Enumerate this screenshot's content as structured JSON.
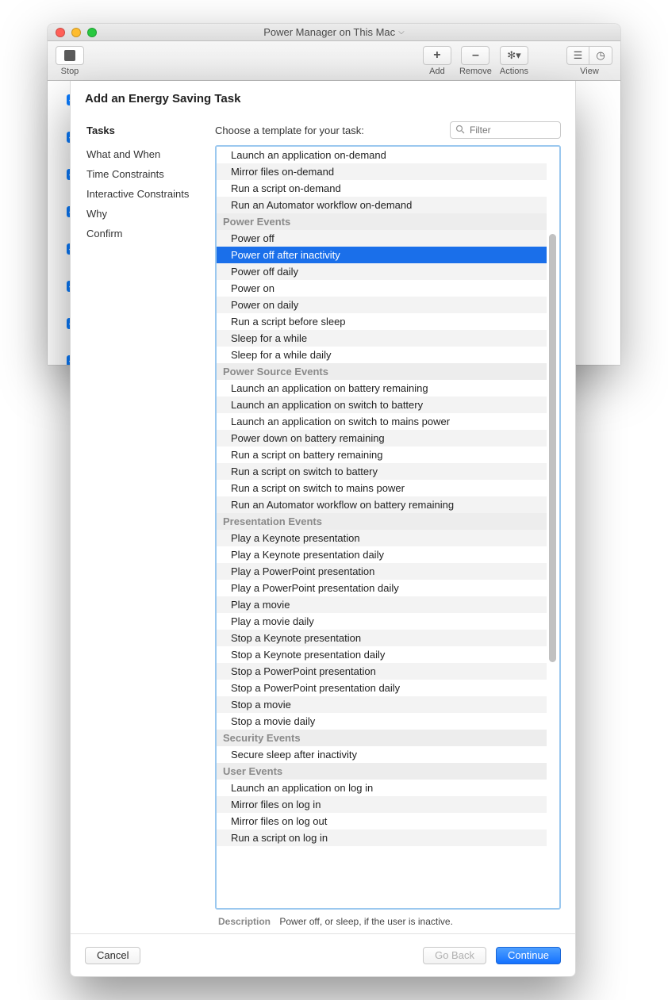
{
  "window": {
    "title": "Power Manager on This Mac"
  },
  "toolbar": {
    "stop_label": "Stop",
    "add_label": "Add",
    "remove_label": "Remove",
    "actions_label": "Actions",
    "view_label": "View"
  },
  "sheet": {
    "title": "Add an Energy Saving Task",
    "sidebar_heading": "Tasks",
    "nav": {
      "what_when": "What and When",
      "time_constraints": "Time Constraints",
      "interactive_constraints": "Interactive Constraints",
      "why": "Why",
      "confirm": "Confirm"
    },
    "prompt": "Choose a template for your task:",
    "filter_placeholder": "Filter",
    "description_label": "Description",
    "description_text": "Power off, or sleep, if the user is inactive.",
    "cancel": "Cancel",
    "go_back": "Go Back",
    "continue": "Continue"
  },
  "templates": {
    "r0": "Launch an application on-demand",
    "r1": "Mirror files on-demand",
    "r2": "Run a script on-demand",
    "r3": "Run an Automator workflow on-demand",
    "g_power": "Power Events",
    "r4": "Power off",
    "r5": "Power off after inactivity",
    "r6": "Power off daily",
    "r7": "Power on",
    "r8": "Power on daily",
    "r9": "Run a script before sleep",
    "r10": "Sleep for a while",
    "r11": "Sleep for a while daily",
    "g_source": "Power Source Events",
    "r12": "Launch an application on battery remaining",
    "r13": "Launch an application on switch to battery",
    "r14": "Launch an application on switch to mains power",
    "r15": "Power down on battery remaining",
    "r16": "Run a script on battery remaining",
    "r17": "Run a script on switch to battery",
    "r18": "Run a script on switch to mains power",
    "r19": "Run an Automator workflow on battery remaining",
    "g_presentation": "Presentation Events",
    "r20": "Play a Keynote presentation",
    "r21": "Play a Keynote presentation daily",
    "r22": "Play a PowerPoint presentation",
    "r23": "Play a PowerPoint presentation daily",
    "r24": "Play a movie",
    "r25": "Play a movie daily",
    "r26": "Stop a Keynote presentation",
    "r27": "Stop a Keynote presentation daily",
    "r28": "Stop a PowerPoint presentation",
    "r29": "Stop a PowerPoint presentation daily",
    "r30": "Stop a movie",
    "r31": "Stop a movie daily",
    "g_security": "Security Events",
    "r32": "Secure sleep after inactivity",
    "g_user": "User Events",
    "r33": "Launch an application on log in",
    "r34": "Mirror files on log in",
    "r35": "Mirror files on log out",
    "r36": "Run a script on log in"
  }
}
